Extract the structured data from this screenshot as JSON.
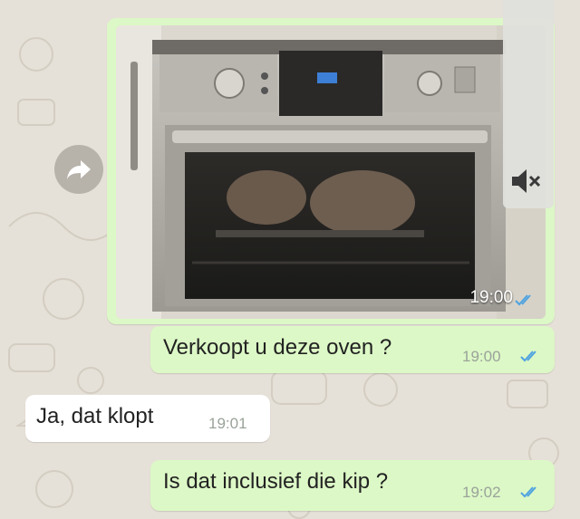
{
  "theme": {
    "outgoing_bubble": "#dcf8c6",
    "incoming_bubble": "#ffffff",
    "chat_background": "#e6e1d8",
    "read_tick_color": "#4fa3e0"
  },
  "forward_button": {
    "icon": "forward-arrow-icon"
  },
  "media_message": {
    "image_description_icon": "oven-photo",
    "time": "19:00",
    "status": "read",
    "overlay_icon": "speaker-muted-icon"
  },
  "messages": [
    {
      "direction": "outgoing",
      "text": "Verkoopt u deze oven ?",
      "time": "19:00",
      "status": "read"
    },
    {
      "direction": "incoming",
      "text": "Ja, dat klopt",
      "time": "19:01"
    },
    {
      "direction": "outgoing",
      "text": "Is dat inclusief die kip ?",
      "time": "19:02",
      "status": "read"
    }
  ]
}
